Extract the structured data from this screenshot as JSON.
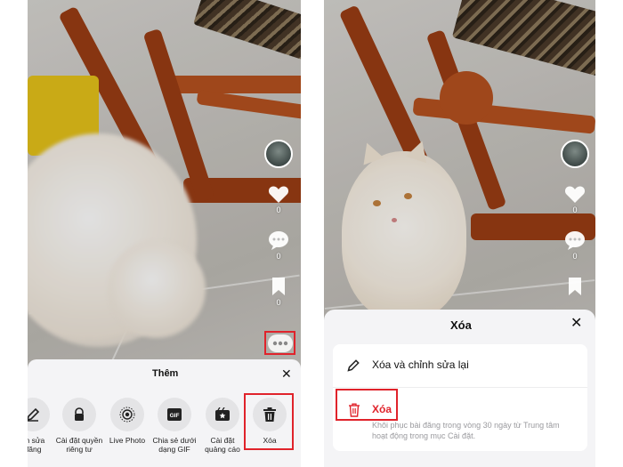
{
  "left_screen": {
    "rail": {
      "like_count": "0",
      "comment_count": "0",
      "bookmark_count": "0"
    },
    "more_sheet": {
      "title": "Thêm",
      "options": [
        {
          "label": "nh sửa\nđăng",
          "icon": "pencil-icon"
        },
        {
          "label": "Cài đặt quyền\nriêng tư",
          "icon": "lock-icon"
        },
        {
          "label": "Live Photo",
          "icon": "live-photo-icon"
        },
        {
          "label": "Chia sẻ dưới\ndạng GIF",
          "icon": "gif-icon"
        },
        {
          "label": "Cài đặt\nquảng cáo",
          "icon": "ad-settings-icon"
        },
        {
          "label": "Xóa",
          "icon": "trash-icon"
        }
      ]
    }
  },
  "right_screen": {
    "rail": {
      "like_count": "0",
      "comment_count": "0"
    },
    "delete_sheet": {
      "title": "Xóa",
      "edit_option": "Xóa và chỉnh sửa lại",
      "delete_option": "Xóa",
      "delete_subtext": "Khôi phục bài đăng trong vòng 30 ngày từ Trung tâm hoạt động trong mục Cài đặt."
    }
  },
  "colors": {
    "highlight": "#e0232b",
    "sheet_bg": "#f4f4f6"
  }
}
